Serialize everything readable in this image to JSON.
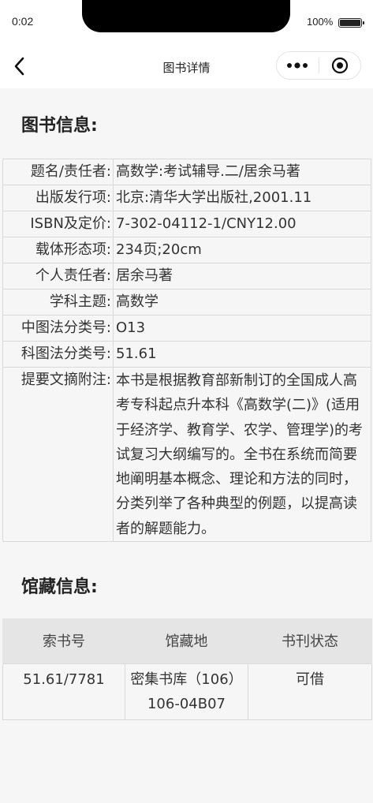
{
  "status_bar": {
    "time": "0:02",
    "battery_text": "100%"
  },
  "nav": {
    "title": "图书详情",
    "more_icon": "more-dots-icon",
    "close_icon": "target-close-icon",
    "back_icon": "chevron-left-icon"
  },
  "book_info": {
    "section_title": "图书信息:",
    "rows": [
      {
        "key": "题名/责任者:",
        "value": "高数学:考试辅导.二/居余马著"
      },
      {
        "key": "出版发行项:",
        "value": "北京:清华大学出版社,2001.11"
      },
      {
        "key": "ISBN及定价:",
        "value": "7-302-04112-1/CNY12.00"
      },
      {
        "key": "载体形态项:",
        "value": "234页;20cm"
      },
      {
        "key": "个人责任者:",
        "value": "居余马著"
      },
      {
        "key": "学科主题:",
        "value": "高数学"
      },
      {
        "key": "中图法分类号:",
        "value": "O13"
      },
      {
        "key": "科图法分类号:",
        "value": "51.61"
      },
      {
        "key": "提要文摘附注:",
        "value": "本书是根据教育部新制订的全国成人高考专科起点升本科《高数学(二)》(适用于经济学、教育学、农学、管理学)的考试复习大纲编写的。全书在系统而简要地阐明基本概念、理论和方法的同时，分类列举了各种典型的例题，以提高读者的解题能力。"
      }
    ]
  },
  "holdings": {
    "section_title": "馆藏信息:",
    "columns": [
      "索书号",
      "馆藏地",
      "书刊状态"
    ],
    "rows": [
      {
        "call_number": "51.61/7781",
        "location": "密集书库（106）",
        "location_code": "106-04B07",
        "status": "可借"
      }
    ]
  }
}
